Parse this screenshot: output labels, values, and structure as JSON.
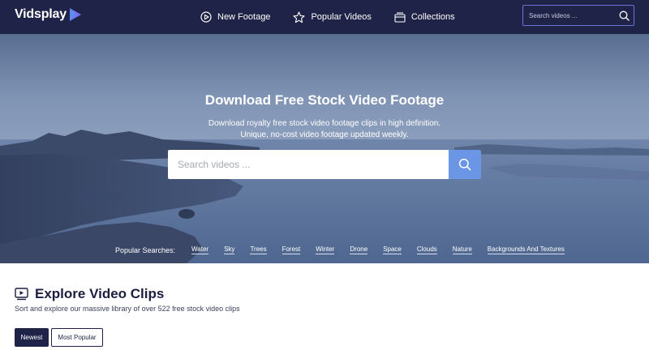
{
  "brand": {
    "name": "Vidsplay"
  },
  "nav": {
    "links": [
      {
        "label": "New Footage",
        "icon": "play-circle-icon"
      },
      {
        "label": "Popular Videos",
        "icon": "star-icon"
      },
      {
        "label": "Collections",
        "icon": "collections-icon"
      }
    ],
    "search": {
      "placeholder": "Search videos ...",
      "icon": "search-icon"
    }
  },
  "hero": {
    "title": "Download Free Stock Video Footage",
    "subtitle_line1": "Download royalty free stock video footage clips in high definition.",
    "subtitle_line2": "Unique, no-cost video footage updated weekly.",
    "search": {
      "placeholder": "Search videos ...",
      "icon": "search-icon"
    },
    "popular": {
      "label": "Popular Searches:",
      "tags": [
        "Water",
        "Sky",
        "Trees",
        "Forest",
        "Winter",
        "Drone",
        "Space",
        "Clouds",
        "Nature",
        "Backgrounds And Textures"
      ]
    }
  },
  "explore": {
    "icon": "video-player-icon",
    "title": "Explore Video Clips",
    "subtitle": "Sort and explore our massive library of over 522 free stock video clips",
    "sort": [
      {
        "label": "Newest",
        "active": true
      },
      {
        "label": "Most Popular",
        "active": false
      }
    ]
  },
  "colors": {
    "nav_bg": "#1e2347",
    "accent": "#6b96e6",
    "search_border": "#6c74d8",
    "text_dark": "#1b1e3f"
  }
}
